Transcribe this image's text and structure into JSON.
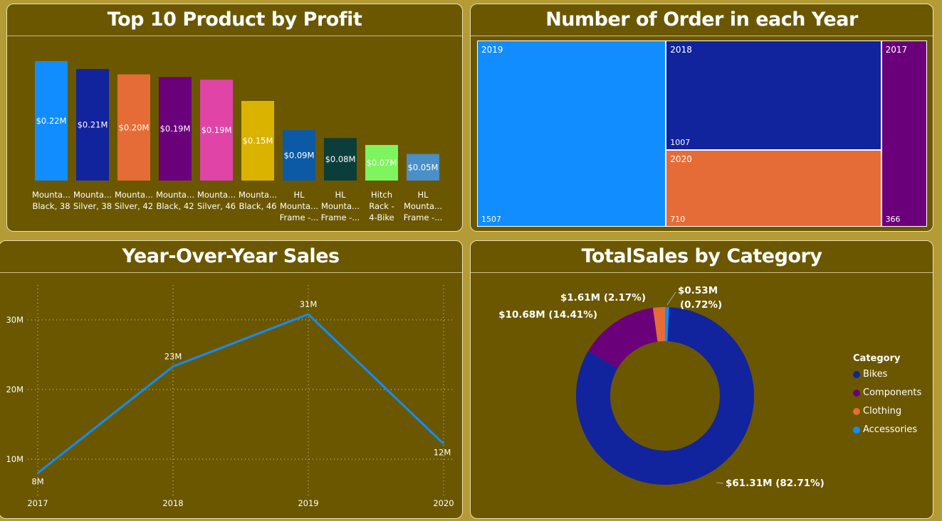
{
  "panels": {
    "profit_title": "Top 10 Product by Profit",
    "orders_title": "Number of Order in each Year",
    "yoy_title": "Year-Over-Year Sales",
    "category_title": "TotalSales by Category"
  },
  "chart_data": [
    {
      "type": "bar",
      "title": "Top 10 Product by Profit",
      "categories": [
        [
          "Mounta...",
          "Black, 38"
        ],
        [
          "Mounta...",
          "Silver, 38"
        ],
        [
          "Mounta...",
          "Silver, 42"
        ],
        [
          "Mounta...",
          "Black, 42"
        ],
        [
          "Mounta...",
          "Silver, 46"
        ],
        [
          "Mounta...",
          "Black, 46"
        ],
        [
          "HL",
          "Mounta...",
          "Frame -..."
        ],
        [
          "HL",
          "Mounta...",
          "Frame -..."
        ],
        [
          "Hitch",
          "Rack -",
          "4-Bike"
        ],
        [
          "HL",
          "Mounta...",
          "Frame -..."
        ]
      ],
      "values": [
        0.225,
        0.21,
        0.2,
        0.195,
        0.19,
        0.15,
        0.095,
        0.08,
        0.067,
        0.05
      ],
      "data_labels": [
        "$0.22M",
        "$0.21M",
        "$0.20M",
        "$0.19M",
        "$0.19M",
        "$0.15M",
        "$0.09M",
        "$0.08M",
        "$0.07M",
        "$0.05M"
      ],
      "colors": [
        "#118dff",
        "#12239e",
        "#e66c37",
        "#6b007b",
        "#e044a7",
        "#d9b300",
        "#0c5aa6",
        "#0b3d3a",
        "#7ef55e",
        "#4a8fc7"
      ],
      "ylim": [
        0,
        0.225
      ]
    },
    {
      "type": "treemap",
      "title": "Number of Order in each Year",
      "items": [
        {
          "label": "2019",
          "value": 1507,
          "color": "#118dff"
        },
        {
          "label": "2018",
          "value": 1007,
          "color": "#12239e"
        },
        {
          "label": "2020",
          "value": 710,
          "color": "#e66c37"
        },
        {
          "label": "2017",
          "value": 366,
          "color": "#6b007b"
        }
      ]
    },
    {
      "type": "line",
      "title": "Year-Over-Year Sales",
      "x": [
        "2017",
        "2018",
        "2019",
        "2020"
      ],
      "y": [
        8,
        23.3,
        30.8,
        12.2
      ],
      "data_labels": [
        "8M",
        "23M",
        "31M",
        "12M"
      ],
      "yticks": [
        "10M",
        "20M",
        "30M"
      ],
      "ylim": [
        5,
        36
      ],
      "color": "#118dff",
      "grid": true
    },
    {
      "type": "pie",
      "title": "TotalSales by Category",
      "legend_title": "Category",
      "legend_position": "right",
      "categories": [
        "Bikes",
        "Components",
        "Clothing",
        "Accessories"
      ],
      "values": [
        61.31,
        10.68,
        1.61,
        0.53
      ],
      "data_labels": [
        "$61.31M (82.71%)",
        "$10.68M (14.41%)",
        "$1.61M (2.17%)",
        "$0.53M (0.72%)"
      ],
      "colors": [
        "#12239e",
        "#6b007b",
        "#e66c37",
        "#118dff"
      ]
    }
  ]
}
